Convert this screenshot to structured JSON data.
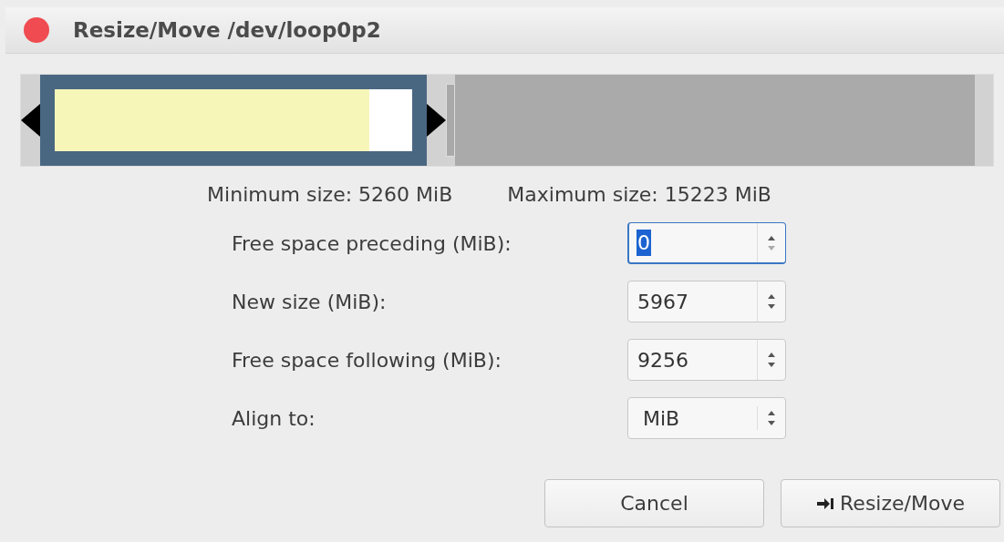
{
  "window": {
    "title": "Resize/Move /dev/loop0p2"
  },
  "partition_bar": {
    "used": {
      "level": 0.88
    }
  },
  "limits": {
    "minimum": "Minimum size: 5260 MiB",
    "maximum": "Maximum size: 15223 MiB"
  },
  "fields": [
    {
      "label": "Free space preceding (MiB):",
      "value": "0",
      "focused": true,
      "kind": "spin"
    },
    {
      "label": "New size (MiB):",
      "value": "5967",
      "focused": false,
      "kind": "spin"
    },
    {
      "label": "Free space following (MiB):",
      "value": "9256",
      "focused": false,
      "kind": "spin"
    },
    {
      "label": "Align to:",
      "value": "MiB",
      "focused": false,
      "kind": "combo"
    }
  ],
  "buttons": [
    {
      "label": "Cancel",
      "kind": "plain"
    },
    {
      "label": "Resize/Move",
      "kind": "apply"
    }
  ]
}
